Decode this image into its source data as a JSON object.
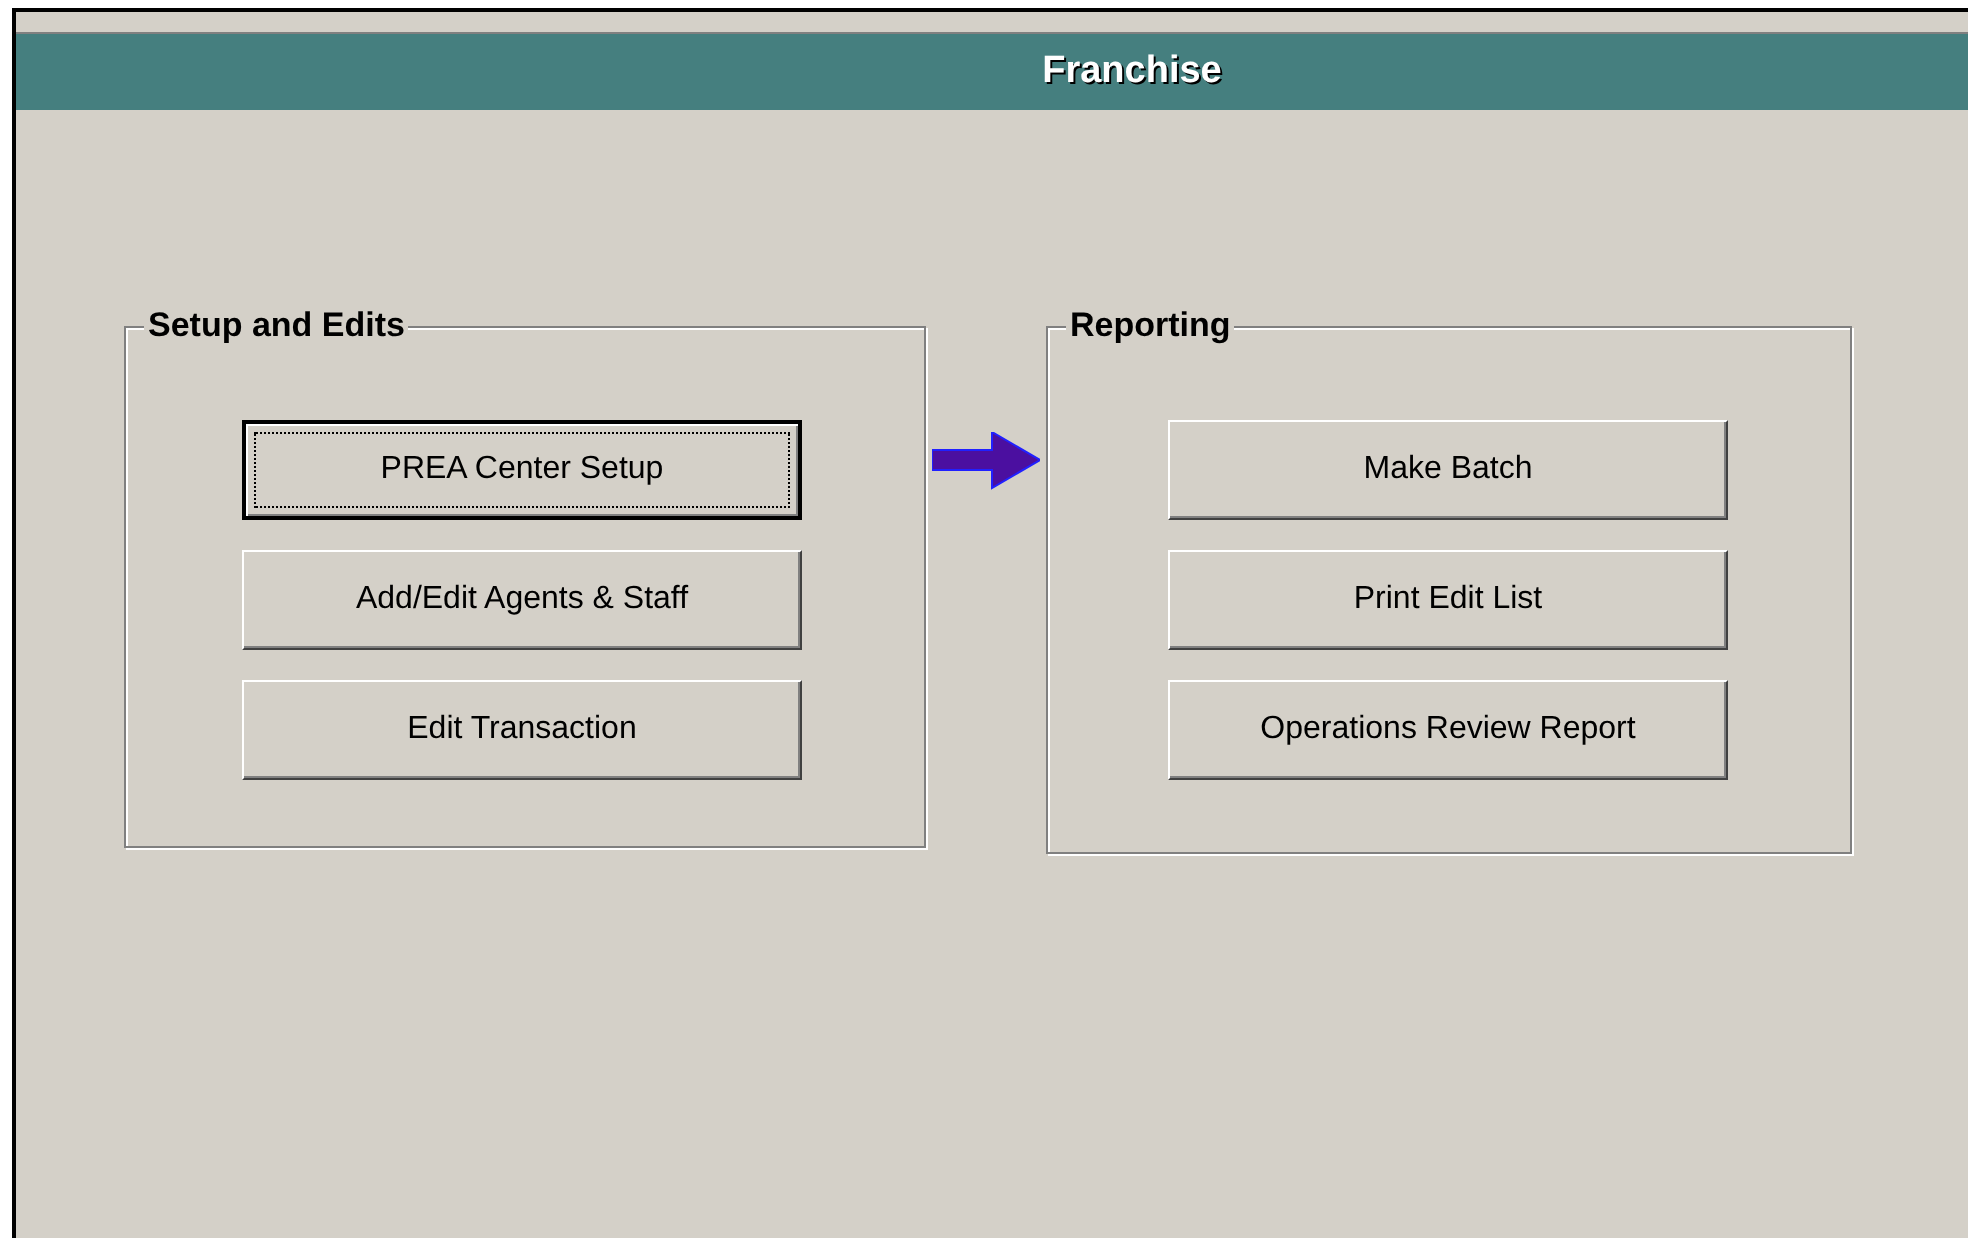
{
  "window": {
    "title": "Franchise"
  },
  "groups": [
    {
      "title": "Setup and Edits",
      "buttons": [
        {
          "label": "PREA Center Setup",
          "focused": true
        },
        {
          "label": "Add/Edit Agents & Staff",
          "focused": false
        },
        {
          "label": "Edit Transaction",
          "focused": false
        }
      ]
    },
    {
      "title": "Reporting",
      "buttons": [
        {
          "label": "Make Batch",
          "focused": false
        },
        {
          "label": "Print Edit List",
          "focused": false
        },
        {
          "label": "Operations Review Report",
          "focused": false
        }
      ]
    }
  ]
}
